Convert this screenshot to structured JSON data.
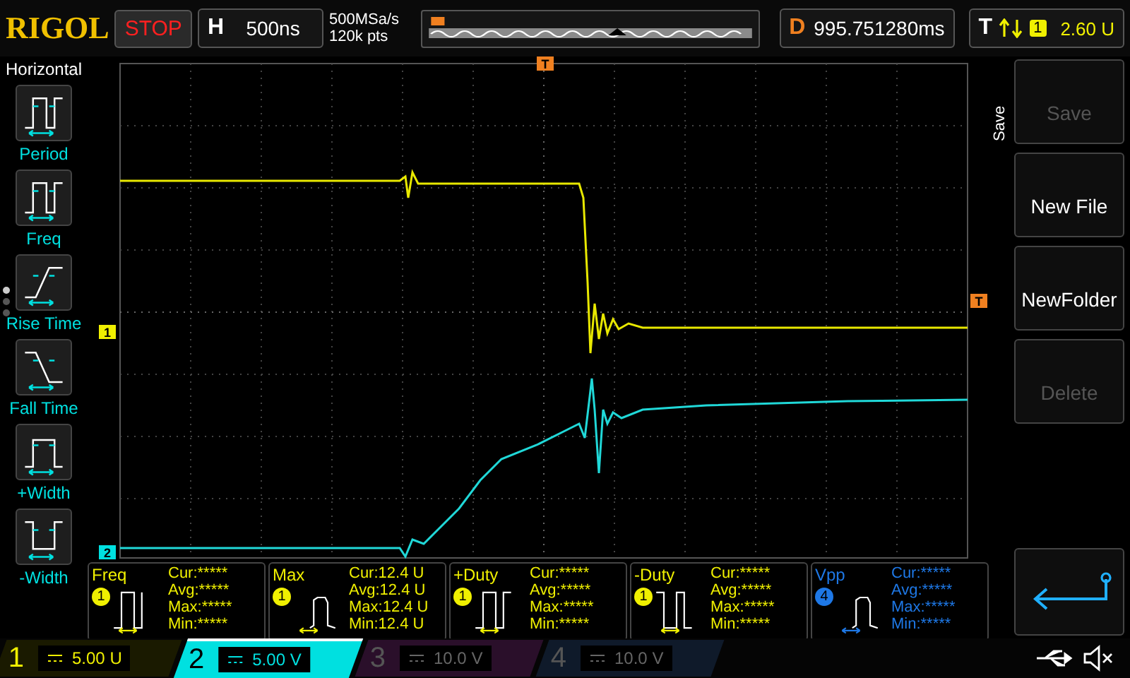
{
  "top_bar": {
    "logo": "RIGOL",
    "run_state": "STOP",
    "horizontal": {
      "label": "H",
      "value": "500ns"
    },
    "sample_rate": "500MSa/s",
    "memory_depth": "120k pts",
    "delay": {
      "label": "D",
      "value": "995.751280ms"
    },
    "trigger": {
      "label": "T",
      "source": "1",
      "level": "2.60 U"
    }
  },
  "left_menu": {
    "title": "Horizontal",
    "page_dots": [
      {
        "selected": true
      },
      {
        "selected": false
      },
      {
        "selected": false
      }
    ],
    "items": [
      {
        "label": "Period",
        "kind": "period"
      },
      {
        "label": "Freq",
        "kind": "freq"
      },
      {
        "label": "Rise Time",
        "kind": "rise"
      },
      {
        "label": "Fall Time",
        "kind": "fall"
      },
      {
        "label": "+Width",
        "kind": "pwidth"
      },
      {
        "label": "-Width",
        "kind": "nwidth"
      }
    ]
  },
  "scope": {
    "markers": [
      {
        "kind": "trigger_position",
        "label": "T"
      },
      {
        "kind": "channel_1",
        "label": "1"
      },
      {
        "kind": "channel_2",
        "label": "2"
      },
      {
        "kind": "trigger_level",
        "label": "T"
      }
    ]
  },
  "measurements": [
    {
      "name": "Freq",
      "kind": "freq",
      "source": "1",
      "color": "#f0f000",
      "rows": [
        {
          "label": "Cur:",
          "value": "*****"
        },
        {
          "label": "Avg:",
          "value": "*****"
        },
        {
          "label": "Max:",
          "value": "*****"
        },
        {
          "label": "Min:",
          "value": "*****"
        }
      ]
    },
    {
      "name": "Max",
      "kind": "max",
      "source": "1",
      "color": "#f0f000",
      "rows": [
        {
          "label": "Cur:",
          "value": "12.4 U"
        },
        {
          "label": "Avg:",
          "value": "12.4 U"
        },
        {
          "label": "Max:",
          "value": "12.4 U"
        },
        {
          "label": "Min:",
          "value": "12.4 U"
        }
      ]
    },
    {
      "name": "+Duty",
      "kind": "pduty",
      "source": "1",
      "color": "#f0f000",
      "rows": [
        {
          "label": "Cur:",
          "value": "*****"
        },
        {
          "label": "Avg:",
          "value": "*****"
        },
        {
          "label": "Max:",
          "value": "*****"
        },
        {
          "label": "Min:",
          "value": "*****"
        }
      ]
    },
    {
      "name": "-Duty",
      "kind": "nduty",
      "source": "1",
      "color": "#f0f000",
      "rows": [
        {
          "label": "Cur:",
          "value": "*****"
        },
        {
          "label": "Avg:",
          "value": "*****"
        },
        {
          "label": "Max:",
          "value": "*****"
        },
        {
          "label": "Min:",
          "value": "*****"
        }
      ]
    },
    {
      "name": "Vpp",
      "kind": "vpp",
      "source": "4",
      "color": "#1e78e6",
      "rows": [
        {
          "label": "Cur:",
          "value": "*****"
        },
        {
          "label": "Avg:",
          "value": "*****"
        },
        {
          "label": "Max:",
          "value": "*****"
        },
        {
          "label": "Min:",
          "value": "*****"
        }
      ]
    }
  ],
  "right_menu": {
    "title": "Save",
    "buttons": [
      {
        "label": "Save",
        "disabled": true
      },
      {
        "label": "New File",
        "disabled": false
      },
      {
        "label": "NewFolder",
        "disabled": false
      },
      {
        "label": "Delete",
        "disabled": true
      }
    ]
  },
  "channels": [
    {
      "number": "1",
      "scale": "5.00 U",
      "enabled": true,
      "selected": false,
      "color": "#f0f000"
    },
    {
      "number": "2",
      "scale": "5.00 V",
      "enabled": true,
      "selected": true,
      "color": "#00e0e0"
    },
    {
      "number": "3",
      "scale": "10.0 V",
      "enabled": false,
      "selected": false,
      "color": "#2a0f2a"
    },
    {
      "number": "4",
      "scale": "10.0 V",
      "enabled": false,
      "selected": false,
      "color": "#0f1a2a"
    }
  ]
}
